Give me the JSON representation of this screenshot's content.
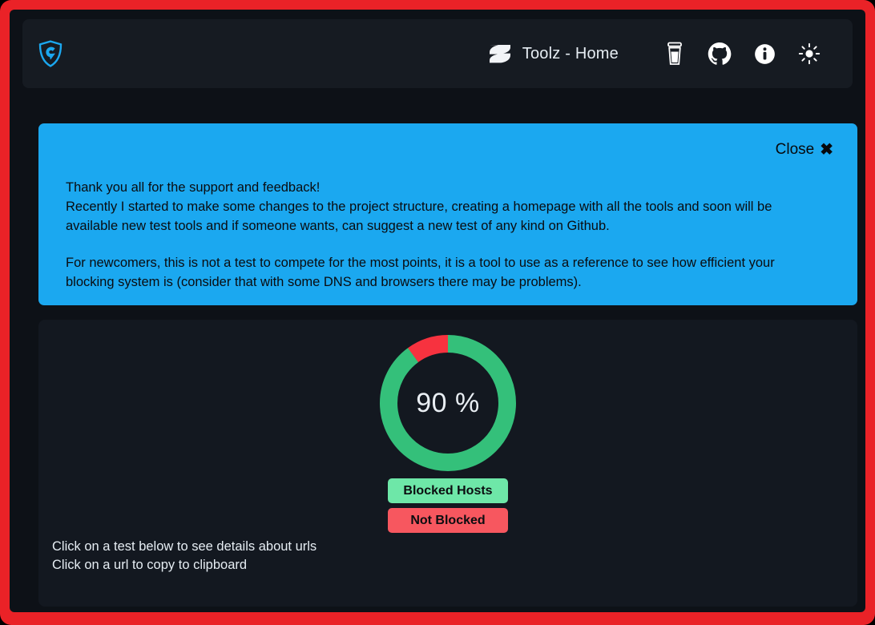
{
  "theme": {
    "frame_color": "#ea2227",
    "window_bg": "#0d1117",
    "header_bg": "#161b22",
    "banner_bg": "#1ba8f0",
    "card_bg": "#131820",
    "blocked_color": "#34c07a",
    "not_blocked_color": "#f7323f",
    "text_color": "#e6edf3",
    "brand_color": "#1ba8f0"
  },
  "header": {
    "brand_icon": "shield-icon",
    "home_logo_icon": "z-logo-icon",
    "home_label": "Toolz - Home",
    "icons": [
      {
        "name": "coffee-cup-icon",
        "label": "Buy me a coffee"
      },
      {
        "name": "github-icon",
        "label": "GitHub"
      },
      {
        "name": "info-icon",
        "label": "Info"
      },
      {
        "name": "sun-icon",
        "label": "Toggle theme"
      }
    ]
  },
  "banner": {
    "close_label": "Close",
    "close_icon": "close-x-icon",
    "line1": "Thank you all for the support and feedback!",
    "line2": "Recently I started to make some changes to the project structure, creating a homepage with all the tools and soon will be",
    "line3": "available new test tools and if someone wants, can suggest a new test of any kind on Github.",
    "line4": "For newcomers, this is not a test to compete for the most points, it is a tool to use as a reference to see how efficient your",
    "line5": "blocking system is (consider that with some DNS and browsers there may be problems)."
  },
  "main": {
    "center_value": "90 %",
    "legend": [
      {
        "label": "Blocked Hosts",
        "color": "#6ee7a8"
      },
      {
        "label": "Not Blocked",
        "color": "#f7575f"
      }
    ],
    "hint1": "Click on a test below to see details about urls",
    "hint2": "Click on a url to copy to clipboard"
  },
  "chart_data": {
    "type": "pie",
    "title": "",
    "categories": [
      "Blocked Hosts",
      "Not Blocked"
    ],
    "values": [
      90,
      10
    ],
    "colors": [
      "#34c07a",
      "#f7323f"
    ],
    "center_label": "90 %",
    "unit": "%",
    "donut": true,
    "legend_position": "bottom"
  }
}
